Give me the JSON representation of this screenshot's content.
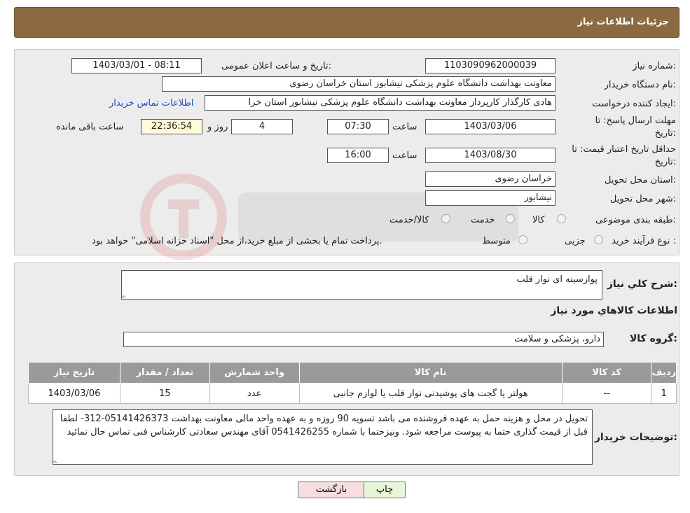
{
  "header": {
    "title": "جزئیات اطلاعات نیاز"
  },
  "need": {
    "number_label": "شماره نیاز:",
    "number_value": "1103090962000039",
    "announce_label": "تاریخ و ساعت اعلان عمومی:",
    "announce_value": "1403/03/01 - 08:11",
    "buyer_label": "نام دستگاه خریدار:",
    "buyer_value": "معاونت بهداشت دانشگاه علوم پزشکی نیشابور استان خراسان رضوی",
    "creator_label": "ایجاد کننده درخواست:",
    "creator_value": "هادی کارگذار کارپرداز معاونت بهداشت دانشگاه علوم پزشکی نیشابور استان خرا",
    "contact_link": "اطلاعات تماس خریدار",
    "deadline_label_1": "مهلت ارسال پاسخ: تا",
    "deadline_label_2": "تاریخ:",
    "deadline_date": "1403/03/06",
    "time_word": "ساعت",
    "deadline_time": "07:30",
    "days_value": "4",
    "days_word": "روز و",
    "countdown": "22:36:54",
    "remaining_word": "ساعت باقی مانده",
    "validity_label_1": "حداقل تاریخ اعتبار قیمت: تا",
    "validity_label_2": "تاریخ:",
    "validity_date": "1403/08/30",
    "validity_time": "16:00",
    "province_label": "استان محل تحویل:",
    "province_value": "خراسان رضوی",
    "city_label": "شهر محل تحویل:",
    "city_value": "نیشابور",
    "category_label": "طبقه بندی موضوعی:",
    "category_options": [
      "کالا",
      "خدمت",
      "کالا/خدمت"
    ],
    "process_label": "نوع فرآیند خرید :",
    "process_options": [
      "جزیی",
      "متوسط"
    ],
    "process_note": "پرداخت تمام یا بخشی از مبلغ خرید،از محل \"اسناد خزانه اسلامی\" خواهد بود."
  },
  "details": {
    "summary_label": "شرح کلي نياز:",
    "summary_value": "پوارسینه ای  نوار قلب",
    "goods_title": "اطلاعات كالاهاي مورد نياز",
    "group_label": "گروه کالا:",
    "group_value": "دارو، پزشکی و سلامت",
    "table": {
      "headers": [
        "ردیف",
        "کد کالا",
        "نام کالا",
        "واحد شمارش",
        "تعداد / مقدار",
        "تاریخ نیاز"
      ],
      "rows": [
        [
          "1",
          "--",
          "هولتر یا گجت های پوشیدنی نوار قلب یا لوازم جانبی",
          "عدد",
          "15",
          "1403/03/06"
        ]
      ]
    },
    "buyer_notes_label": "توضیحات خریدار:",
    "buyer_notes_value": "تحویل در محل و هزینه حمل به عهده فروشنده می باشد تسویه 90 روزه و به عهده واحد مالی معاونت بهداشت 05141426373-312- لطفا قبل از قیمت گذاری حتما به پیوست مراجعه شود. ونیزحتما  با شماره 0541426255 آقای مهندس سعادتی کارشناس فنی  تماس حال نمائید"
  },
  "buttons": {
    "back": "بازگشت",
    "print": "چاپ"
  },
  "colors": {
    "header_bg": "#8b6a42",
    "table_header_bg": "#9a9a9a",
    "link": "#1a4ec8"
  }
}
